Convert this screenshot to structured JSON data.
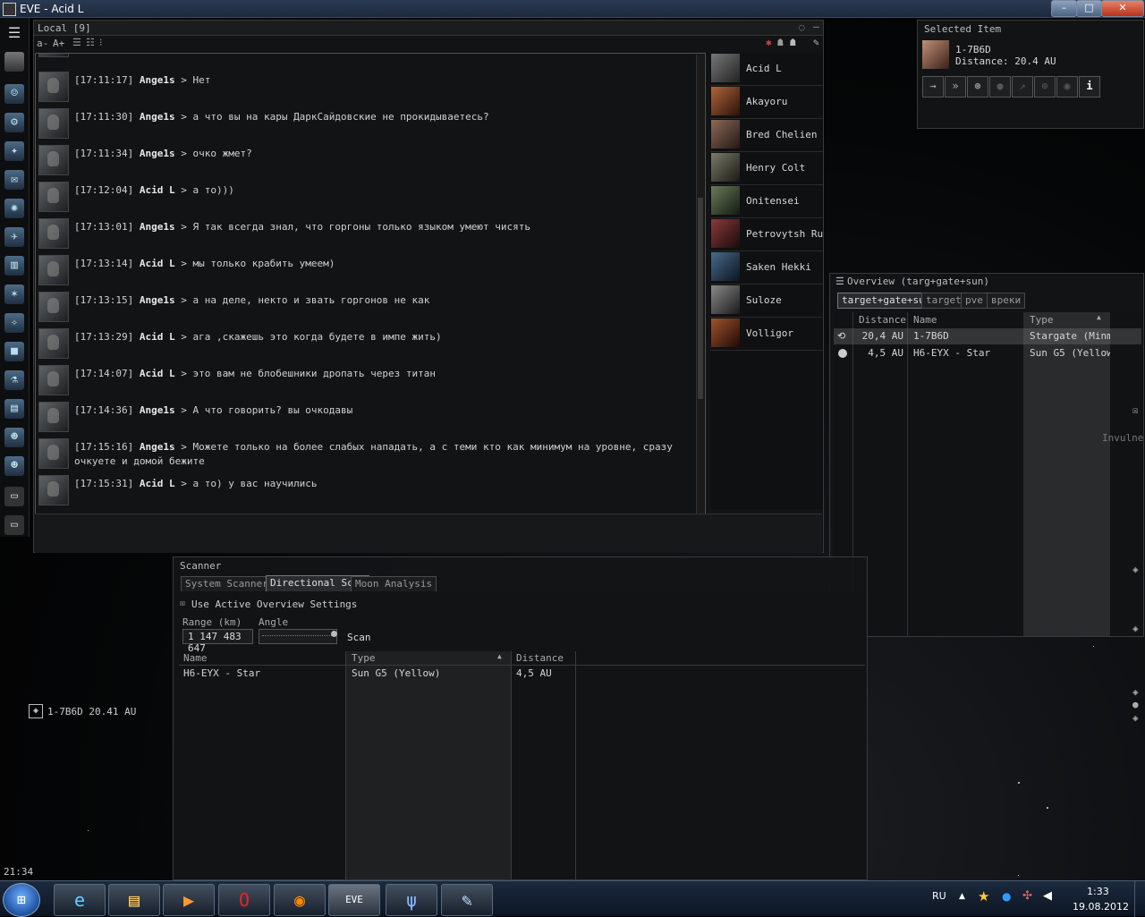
{
  "window": {
    "title": "EVE - Acid L"
  },
  "neocom": {
    "clock": "21:34"
  },
  "chat": {
    "title": "Local [9]",
    "font_controls": [
      "a-",
      "A+"
    ],
    "messages": [
      {
        "time": "[17:11:17]",
        "sender": "Ange1s",
        "text": "> Нет"
      },
      {
        "time": "[17:11:30]",
        "sender": "Ange1s",
        "text": "> а что вы на кары ДаркСайдовские не прокидываетесь?"
      },
      {
        "time": "[17:11:34]",
        "sender": "Ange1s",
        "text": "> очко жмет?"
      },
      {
        "time": "[17:12:04]",
        "sender": "Acid L",
        "text": "> а то)))"
      },
      {
        "time": "[17:13:01]",
        "sender": "Ange1s",
        "text": "> Я так всегда знал, что горгоны только языком умеют чисять"
      },
      {
        "time": "[17:13:14]",
        "sender": "Acid L",
        "text": "> мы только крабить умеем)"
      },
      {
        "time": "[17:13:15]",
        "sender": "Ange1s",
        "text": "> а на деле, некто и звать горгонов не как"
      },
      {
        "time": "[17:13:29]",
        "sender": "Acid L",
        "text": "> ага ,скажешь это когда будете в импе жить)"
      },
      {
        "time": "[17:14:07]",
        "sender": "Acid L",
        "text": "> это вам не блобешники дропать через титан"
      },
      {
        "time": "[17:14:36]",
        "sender": "Ange1s",
        "text": "> А что говорить? вы очкодавы"
      },
      {
        "time": "[17:15:16]",
        "sender": "Ange1s",
        "text": "> Можете только на более слабых нападать, а с теми кто как минимум на уровне, сразу очкуете и домой бежите"
      },
      {
        "time": "[17:15:31]",
        "sender": "Acid L",
        "text": "> а то) у вас научились"
      }
    ],
    "members": [
      "Acid L",
      "Akayoru",
      "Bred Chelien",
      "Henry Colt",
      "Onitensei",
      "Petrovytsh RusCo",
      "Saken Hekki",
      "Suloze",
      "Volligor"
    ]
  },
  "selected_item": {
    "title": "Selected Item",
    "name": "1-7B6D",
    "distance": "Distance: 20.4 AU",
    "actions": [
      "approach-icon",
      "warp-to-icon",
      "jump-icon",
      "orbit-icon",
      "keep-at-range-icon",
      "lock-target-icon",
      "look-at-icon",
      "show-info-icon"
    ]
  },
  "overview": {
    "title": "Overview (targ+gate+sun)",
    "tabs": [
      "target+gate+sun",
      "target",
      "pve",
      "вреки"
    ],
    "columns": [
      "Distance",
      "Name",
      "Type"
    ],
    "rows": [
      {
        "distance": "20,4 AU",
        "name": "1-7B6D",
        "type": "Stargate (Minma"
      },
      {
        "distance": "4,5 AU",
        "name": "H6-EYX - Star",
        "type": "Sun G5 (Yellow)"
      }
    ],
    "status": "Invulnerat"
  },
  "scanner": {
    "title": "Scanner",
    "tabs": [
      "System Scanner",
      "Directional Scan",
      "Moon Analysis"
    ],
    "use_overview_label": "Use Active Overview Settings",
    "range_label": "Range (km)",
    "angle_label": "Angle",
    "range_value": "1 147 483 647",
    "scan_label": "Scan",
    "columns": [
      "Name",
      "Type",
      "Distance"
    ],
    "rows": [
      {
        "name": "H6-EYX - Star",
        "type": "Sun G5 (Yellow)",
        "distance": "4,5 AU"
      }
    ]
  },
  "bracket": {
    "label": "1-7B6D 20.41 AU"
  },
  "taskbar": {
    "language": "RU",
    "time": "1:33",
    "date": "19.08.2012",
    "apps": [
      "ie-icon",
      "explorer-icon",
      "media-player-icon",
      "opera-icon",
      "firefox-icon",
      "eve-icon",
      "app-icon",
      "notepad-icon"
    ]
  }
}
